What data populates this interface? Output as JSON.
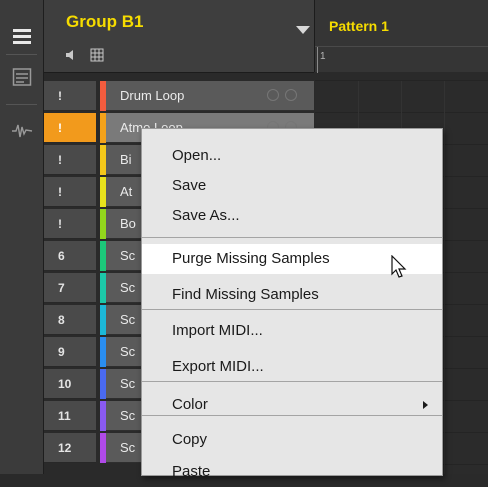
{
  "header": {
    "group_title": "Group B1",
    "pattern_title": "Pattern 1",
    "ruler_first": "1"
  },
  "sounds": [
    {
      "num": "!",
      "name": "Drum Loop",
      "color": "#f25c3e"
    },
    {
      "num": "!",
      "name": "Atmo Loop",
      "color": "#f4a21a"
    },
    {
      "num": "!",
      "name": "Bi",
      "color": "#f4c81a"
    },
    {
      "num": "!",
      "name": "At",
      "color": "#e8e21c"
    },
    {
      "num": "!",
      "name": "Bo",
      "color": "#92d61c"
    },
    {
      "num": "6",
      "name": "Sc",
      "color": "#1cc87a"
    },
    {
      "num": "7",
      "name": "Sc",
      "color": "#1cc8a8"
    },
    {
      "num": "8",
      "name": "Sc",
      "color": "#1cb8d8"
    },
    {
      "num": "9",
      "name": "Sc",
      "color": "#2a8ef0"
    },
    {
      "num": "10",
      "name": "Sc",
      "color": "#4a6af0"
    },
    {
      "num": "11",
      "name": "Sc",
      "color": "#8a5af0"
    },
    {
      "num": "12",
      "name": "Sc",
      "color": "#b04ae8"
    }
  ],
  "selected_index": 1,
  "menu": {
    "items": [
      {
        "label": "Open..."
      },
      {
        "label": "Save"
      },
      {
        "label": "Save As..."
      },
      {
        "label": "Purge Missing Samples"
      },
      {
        "label": "Find Missing Samples"
      },
      {
        "label": "Import MIDI..."
      },
      {
        "label": "Export MIDI..."
      },
      {
        "label": "Color"
      },
      {
        "label": "Copy"
      },
      {
        "label": "Paste"
      }
    ],
    "highlighted": "Purge Missing Samples"
  },
  "colors": {
    "accent": "#f6dc00",
    "selected": "#f29a1c"
  }
}
